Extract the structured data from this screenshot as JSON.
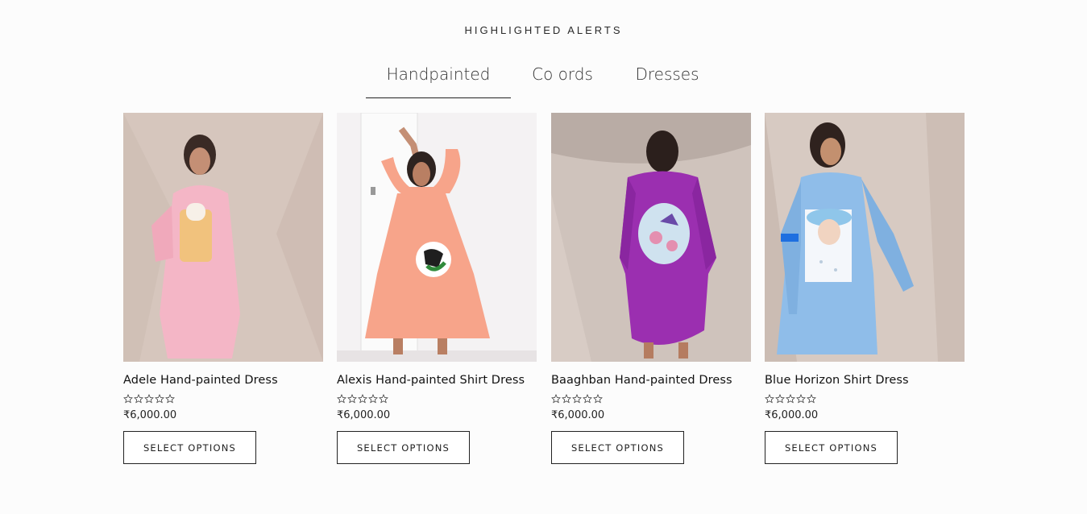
{
  "section": {
    "title": "HIGHLIGHTED ALERTS"
  },
  "tabs": [
    {
      "label": "Handpainted",
      "active": true
    },
    {
      "label": "Co ords",
      "active": false
    },
    {
      "label": "Dresses",
      "active": false
    }
  ],
  "products": [
    {
      "name": "Adele Hand-painted Dress",
      "price": "₹6,000.00",
      "rating": 0,
      "button": "SELECT OPTIONS",
      "dress_color": "#f4b6c6",
      "backdrop": "#d9cbc3"
    },
    {
      "name": "Alexis Hand-painted Shirt Dress",
      "price": "₹6,000.00",
      "rating": 0,
      "button": "SELECT OPTIONS",
      "dress_color": "#f7a48a",
      "backdrop": "#f3f1f2"
    },
    {
      "name": "Baaghban Hand-painted Dress",
      "price": "₹6,000.00",
      "rating": 0,
      "button": "SELECT OPTIONS",
      "dress_color": "#9b2fb0",
      "backdrop": "#cbbfb8"
    },
    {
      "name": "Blue Horizon Shirt Dress",
      "price": "₹6,000.00",
      "rating": 0,
      "button": "SELECT OPTIONS",
      "dress_color": "#8fbde9",
      "backdrop": "#d8cbc4"
    }
  ]
}
